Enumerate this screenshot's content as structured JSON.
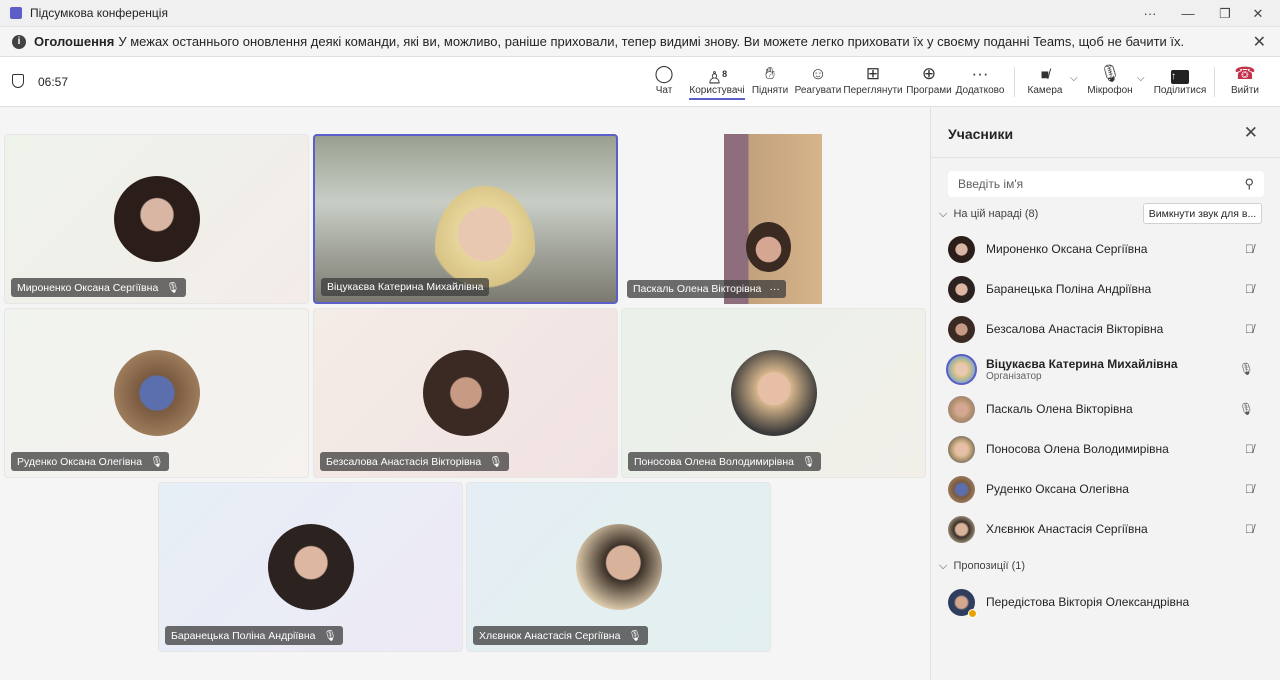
{
  "window": {
    "title": "Підсумкова конференція",
    "more": "···",
    "minimize": "—",
    "restore": "❐",
    "close": "✕"
  },
  "banner": {
    "label": "Оголошення",
    "text": "У межах останнього оновлення деякі команди, які ви, можливо, раніше приховали, тепер видимі знову. Ви можете легко приховати їх у своєму поданні Teams, щоб не бачити їх.",
    "close": "✕"
  },
  "toolbar": {
    "timer": "06:57",
    "participants_count": "8",
    "buttons": [
      {
        "label": "Чат",
        "icon": "chat-icon",
        "glyph": "💬"
      },
      {
        "label": "Користувачі",
        "icon": "people-icon",
        "glyph": "👤"
      },
      {
        "label": "Підняти",
        "icon": "hand-icon",
        "glyph": "✋"
      },
      {
        "label": "Реагувати",
        "icon": "emoji-icon",
        "glyph": "☺"
      },
      {
        "label": "Переглянути",
        "icon": "view-icon",
        "glyph": "⊞"
      },
      {
        "label": "Програми",
        "icon": "apps-icon",
        "glyph": "⊞"
      },
      {
        "label": "Додатково",
        "icon": "more-icon",
        "glyph": "···"
      },
      {
        "label": "Камера",
        "icon": "camera-off-icon",
        "glyph": "■"
      },
      {
        "label": "Мікрофон",
        "icon": "mic-off-icon",
        "glyph": "🎙"
      },
      {
        "label": "Поділитися",
        "icon": "share-icon",
        "glyph": "⬆"
      },
      {
        "label": "Вийти",
        "icon": "hangup-icon",
        "glyph": "☎"
      }
    ]
  },
  "tiles": [
    {
      "name": "Мироненко Оксана Сергіївна",
      "muted": true
    },
    {
      "name": "Віцукаєва Катерина Михайлівна",
      "muted": false
    },
    {
      "name": "Паскаль Олена Вікторівна",
      "muted": false,
      "more": "···"
    },
    {
      "name": "Руденко Оксана Олегівна",
      "muted": true
    },
    {
      "name": "Безсалова Анастасія Вікторівна",
      "muted": true
    },
    {
      "name": "Поносова Олена Володимирівна",
      "muted": true
    },
    {
      "name": "Баранецька Поліна Андріївна",
      "muted": true
    },
    {
      "name": "Хлєвнюк Анастасія Сергіївна",
      "muted": true
    }
  ],
  "panel": {
    "title": "Учасники",
    "search_placeholder": "Введіть ім'я",
    "in_meeting": "На цій нараді (8)",
    "mute_all": "Вимкнути звук для в...",
    "suggestions": "Пропозиції (1)",
    "participants": [
      {
        "name": "Мироненко Оксана Сергіївна",
        "muted": true
      },
      {
        "name": "Баранецька Поліна Андріївна",
        "muted": true
      },
      {
        "name": "Безсалова Анастасія Вікторівна",
        "muted": true
      },
      {
        "name": "Віцукаєва Катерина Михайлівна",
        "role": "Організатор",
        "muted": false
      },
      {
        "name": "Паскаль Олена Вікторівна",
        "muted": false
      },
      {
        "name": "Поносова Олена Володимирівна",
        "muted": true
      },
      {
        "name": "Руденко Оксана Олегівна",
        "muted": true
      },
      {
        "name": "Хлєвнюк Анастасія Сергіївна",
        "muted": true
      }
    ],
    "suggested": [
      {
        "name": "Передістова Вікторія Олександрівна"
      }
    ]
  },
  "colors": {
    "accent": "#5b5fc7",
    "hangup": "#c4314b"
  }
}
